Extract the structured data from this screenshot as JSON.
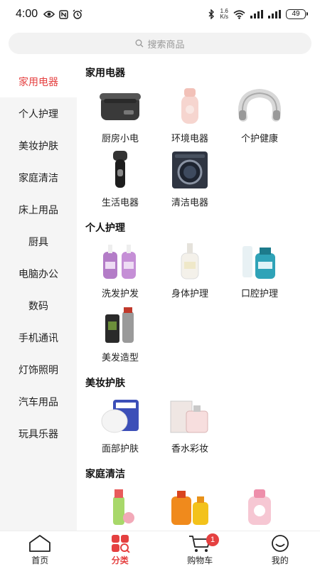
{
  "status_bar": {
    "time": "4:00",
    "net_speed_value": "1.6",
    "net_speed_unit": "K/s",
    "battery": "49"
  },
  "search": {
    "placeholder": "搜索商品"
  },
  "sidebar": {
    "items": [
      {
        "label": "家用电器",
        "active": true
      },
      {
        "label": "个人护理"
      },
      {
        "label": "美妆护肤"
      },
      {
        "label": "家庭清洁"
      },
      {
        "label": "床上用品"
      },
      {
        "label": "厨具"
      },
      {
        "label": "电脑办公"
      },
      {
        "label": "数码"
      },
      {
        "label": "手机通讯"
      },
      {
        "label": "灯饰照明"
      },
      {
        "label": "汽车用品"
      },
      {
        "label": "玩具乐器"
      }
    ]
  },
  "sections": [
    {
      "title": "家用电器",
      "items": [
        {
          "label": "厨房小电",
          "icon": "rice-cooker-image"
        },
        {
          "label": "环境电器",
          "icon": "humidifier-image"
        },
        {
          "label": "个护健康",
          "icon": "neck-massager-image"
        },
        {
          "label": "生活电器",
          "icon": "shaver-image"
        },
        {
          "label": "清洁电器",
          "icon": "washing-machine-image"
        }
      ]
    },
    {
      "title": "个人护理",
      "items": [
        {
          "label": "洗发护发",
          "icon": "shampoo-bottles-image"
        },
        {
          "label": "身体护理",
          "icon": "body-lotion-image"
        },
        {
          "label": "口腔护理",
          "icon": "mouthwash-image"
        },
        {
          "label": "美发造型",
          "icon": "hair-spray-image"
        }
      ]
    },
    {
      "title": "美妆护肤",
      "items": [
        {
          "label": "面部护肤",
          "icon": "face-mask-image"
        },
        {
          "label": "香水彩妆",
          "icon": "perfume-image"
        }
      ]
    },
    {
      "title": "家庭清洁",
      "items": [
        {
          "label": "",
          "icon": "cleaning-spray-image"
        },
        {
          "label": "",
          "icon": "detergent-bottles-image"
        },
        {
          "label": "",
          "icon": "laundry-liquid-image"
        }
      ]
    }
  ],
  "bottom_nav": {
    "items": [
      {
        "label": "首页"
      },
      {
        "label": "分类",
        "active": true
      },
      {
        "label": "购物车",
        "badge": "1"
      },
      {
        "label": "我的"
      }
    ]
  },
  "colors": {
    "accent": "#e54040",
    "sidebar_bg": "#f5f5f5",
    "search_bg": "#f2f2f2"
  }
}
